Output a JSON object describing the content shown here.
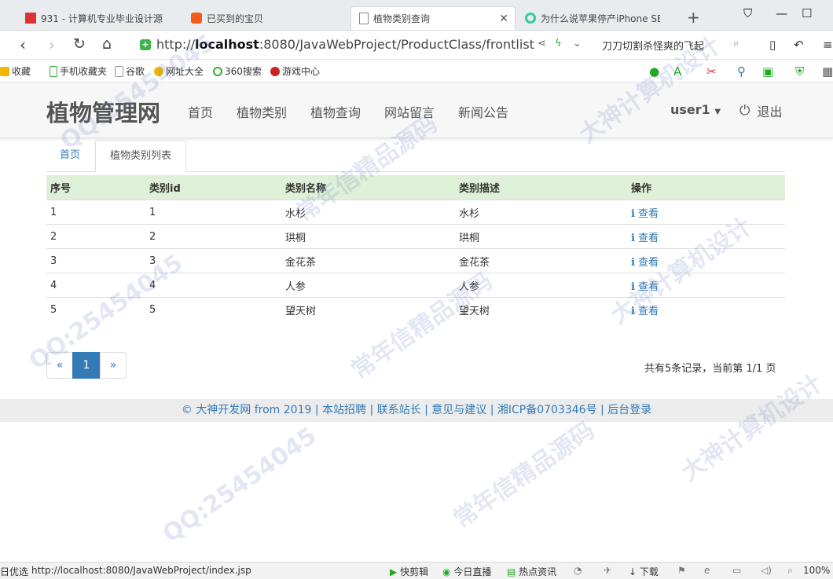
{
  "browser": {
    "tabs": [
      {
        "title": "931 - 计算机专业毕业设计源",
        "icon": "red-square-favicon-icon"
      },
      {
        "title": "已买到的宝贝",
        "icon": "taobao-favicon-icon"
      },
      {
        "title": "植物类别查询",
        "icon": "page-icon",
        "active": true
      },
      {
        "title": "为什么说苹果停产iPhone SE",
        "icon": "360-favicon-icon"
      }
    ],
    "new_tab": "+",
    "url_host": "http://",
    "url_bold": "localhost",
    "url_rest": ":8080/JavaWebProject/ProductClass/frontlist",
    "search_hint": "刀刀切割杀怪爽的飞起",
    "bookmarks": [
      "收藏",
      "手机收藏夹",
      "谷歌",
      "网址大全",
      "360搜索",
      "游戏中心"
    ]
  },
  "header": {
    "brand": "植物管理网",
    "nav": [
      "首页",
      "植物类别",
      "植物查询",
      "网站留言",
      "新闻公告"
    ],
    "user": "user1",
    "logout": "退出"
  },
  "breadcrumb": {
    "home": "首页",
    "current": "植物类别列表"
  },
  "table": {
    "headers": [
      "序号",
      "类别id",
      "类别名称",
      "类别描述",
      "操作"
    ],
    "view_label": "查看",
    "rows": [
      [
        "1",
        "1",
        "水杉",
        "水杉"
      ],
      [
        "2",
        "2",
        "珙桐",
        "珙桐"
      ],
      [
        "3",
        "3",
        "金花茶",
        "金花茶"
      ],
      [
        "4",
        "4",
        "人参",
        "人参"
      ],
      [
        "5",
        "5",
        "望天树",
        "望天树"
      ]
    ]
  },
  "pagination": {
    "prev": "«",
    "page": "1",
    "next": "»",
    "info": "共有5条记录，当前第 1/1 页"
  },
  "footer": {
    "text": "© 大神开发网 from 2019 | 本站招聘 | 联系站长 | 意见与建议 | 湘ICP备0703346号 | 后台登录"
  },
  "statusbar": {
    "left": "日优选",
    "url": "http://localhost:8080/JavaWebProject/index.jsp",
    "items": [
      "快剪辑",
      "今日直播",
      "热点资讯",
      "下载"
    ],
    "zoom": "100%"
  },
  "watermarks": [
    "QQ:25454045",
    "常年信精品源码",
    "大神计算机设计",
    "QQ:25454045",
    "常年信精品源码",
    "大神计算机设计",
    "QQ:25454045",
    "常年信精品源码",
    "大神计算机设计"
  ]
}
